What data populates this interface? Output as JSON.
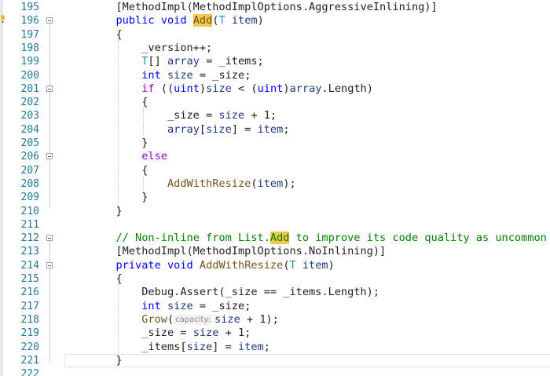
{
  "editor": {
    "lines": [
      {
        "num": "195",
        "tokens": [
          {
            "t": "        [MethodImpl(MethodImplOptions.AggressiveInlining)]"
          }
        ]
      },
      {
        "num": "196",
        "fold": true,
        "tokens": [
          {
            "t": "        "
          },
          {
            "t": "public",
            "c": "kw"
          },
          {
            "t": " "
          },
          {
            "t": "void",
            "c": "kw"
          },
          {
            "t": " "
          },
          {
            "t": "Add",
            "c": "mtd hl"
          },
          {
            "t": "("
          },
          {
            "t": "T",
            "c": "tp"
          },
          {
            "t": " "
          },
          {
            "t": "item",
            "c": "var"
          },
          {
            "t": ")"
          }
        ]
      },
      {
        "num": "197",
        "tokens": [
          {
            "t": "        {"
          }
        ]
      },
      {
        "num": "198",
        "tokens": [
          {
            "t": "            _version++;"
          }
        ]
      },
      {
        "num": "199",
        "tokens": [
          {
            "t": "            "
          },
          {
            "t": "T",
            "c": "tp"
          },
          {
            "t": "[] "
          },
          {
            "t": "array",
            "c": "var"
          },
          {
            "t": " = _items;"
          }
        ]
      },
      {
        "num": "200",
        "tokens": [
          {
            "t": "            "
          },
          {
            "t": "int",
            "c": "kw"
          },
          {
            "t": " "
          },
          {
            "t": "size",
            "c": "var"
          },
          {
            "t": " = _size;"
          }
        ]
      },
      {
        "num": "201",
        "fold": true,
        "tokens": [
          {
            "t": "            "
          },
          {
            "t": "if",
            "c": "ctl"
          },
          {
            "t": " (("
          },
          {
            "t": "uint",
            "c": "kw"
          },
          {
            "t": ")"
          },
          {
            "t": "size",
            "c": "var"
          },
          {
            "t": " < ("
          },
          {
            "t": "uint",
            "c": "kw"
          },
          {
            "t": ")"
          },
          {
            "t": "array",
            "c": "var"
          },
          {
            "t": ".Length)"
          }
        ]
      },
      {
        "num": "202",
        "tokens": [
          {
            "t": "            {"
          }
        ]
      },
      {
        "num": "203",
        "tokens": [
          {
            "t": "                _size = "
          },
          {
            "t": "size",
            "c": "var"
          },
          {
            "t": " + 1;"
          }
        ]
      },
      {
        "num": "204",
        "tokens": [
          {
            "t": "                "
          },
          {
            "t": "array",
            "c": "var"
          },
          {
            "t": "["
          },
          {
            "t": "size",
            "c": "var"
          },
          {
            "t": "] = "
          },
          {
            "t": "item",
            "c": "var"
          },
          {
            "t": ";"
          }
        ]
      },
      {
        "num": "205",
        "tokens": [
          {
            "t": "            }"
          }
        ]
      },
      {
        "num": "206",
        "fold": true,
        "tokens": [
          {
            "t": "            "
          },
          {
            "t": "else",
            "c": "ctl"
          }
        ]
      },
      {
        "num": "207",
        "tokens": [
          {
            "t": "            {"
          }
        ]
      },
      {
        "num": "208",
        "tokens": [
          {
            "t": "                "
          },
          {
            "t": "AddWithResize",
            "c": "mtd"
          },
          {
            "t": "("
          },
          {
            "t": "item",
            "c": "var"
          },
          {
            "t": ");"
          }
        ]
      },
      {
        "num": "209",
        "tokens": [
          {
            "t": "            }"
          }
        ]
      },
      {
        "num": "210",
        "tokens": [
          {
            "t": "        }"
          }
        ]
      },
      {
        "num": "211",
        "tokens": [
          {
            "t": ""
          }
        ]
      },
      {
        "num": "212",
        "fold": true,
        "tokens": [
          {
            "t": "        "
          },
          {
            "t": "// Non-inline from List.",
            "c": "cm"
          },
          {
            "t": "Add",
            "c": "cm hl"
          },
          {
            "t": " to improve its code quality as uncommon path",
            "c": "cm"
          }
        ]
      },
      {
        "num": "213",
        "tokens": [
          {
            "t": "        [MethodImpl(MethodImplOptions.NoInlining)]"
          }
        ]
      },
      {
        "num": "214",
        "fold": true,
        "tokens": [
          {
            "t": "        "
          },
          {
            "t": "private",
            "c": "kw"
          },
          {
            "t": " "
          },
          {
            "t": "void",
            "c": "kw"
          },
          {
            "t": " "
          },
          {
            "t": "AddWithResize",
            "c": "mtd"
          },
          {
            "t": "("
          },
          {
            "t": "T",
            "c": "tp"
          },
          {
            "t": " "
          },
          {
            "t": "item",
            "c": "var"
          },
          {
            "t": ")"
          }
        ]
      },
      {
        "num": "215",
        "tokens": [
          {
            "t": "        {"
          }
        ]
      },
      {
        "num": "216",
        "tokens": [
          {
            "t": "            Debug.Assert(_size == _items.Length);"
          }
        ]
      },
      {
        "num": "217",
        "tokens": [
          {
            "t": "            "
          },
          {
            "t": "int",
            "c": "kw"
          },
          {
            "t": " "
          },
          {
            "t": "size",
            "c": "var"
          },
          {
            "t": " = _size;"
          }
        ]
      },
      {
        "num": "218",
        "tokens": [
          {
            "t": "            "
          },
          {
            "t": "Grow",
            "c": "mtd"
          },
          {
            "t": "("
          },
          {
            "hint": "capacity:"
          },
          {
            "t": "size",
            "c": "var"
          },
          {
            "t": " + 1);"
          }
        ]
      },
      {
        "num": "219",
        "tokens": [
          {
            "t": "            _size = "
          },
          {
            "t": "size",
            "c": "var"
          },
          {
            "t": " + 1;"
          }
        ]
      },
      {
        "num": "220",
        "tokens": [
          {
            "t": "            _items["
          },
          {
            "t": "size",
            "c": "var"
          },
          {
            "t": "] = "
          },
          {
            "t": "item",
            "c": "var"
          },
          {
            "t": ";"
          }
        ]
      },
      {
        "num": "221",
        "current": true,
        "tokens": [
          {
            "t": "        }"
          }
        ]
      },
      {
        "num": "222",
        "tokens": [
          {
            "t": ""
          }
        ]
      }
    ]
  }
}
